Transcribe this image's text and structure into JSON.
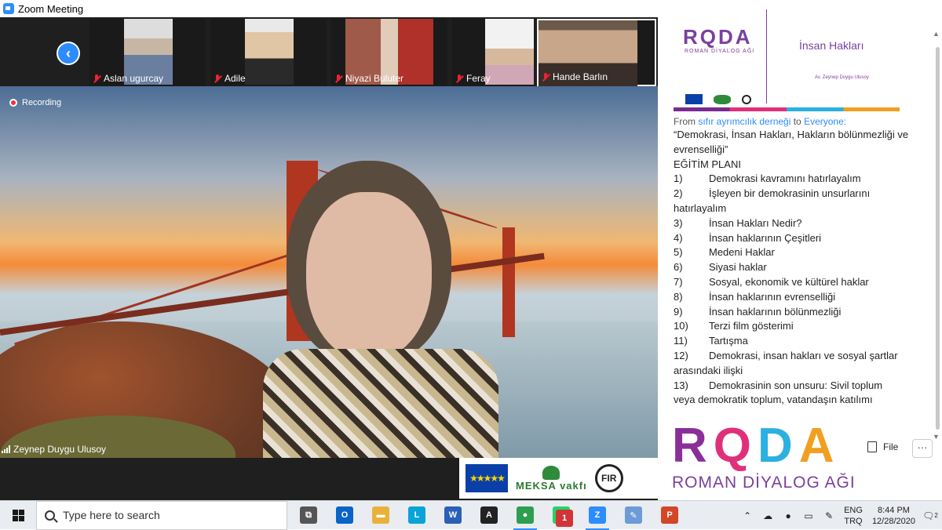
{
  "window": {
    "title": "Zoom Meeting"
  },
  "gallery": {
    "participants": [
      {
        "name": "Aslan ugurcay"
      },
      {
        "name": "Adile"
      },
      {
        "name": "Niyazi Buluter"
      },
      {
        "name": "Feray"
      },
      {
        "name": "Hande Barlın"
      }
    ]
  },
  "main": {
    "recording_label": "Recording",
    "speaker_name": "Zeynep Duygu Ulusoy"
  },
  "sponsors": {
    "eu_stars": "★★★★★",
    "meksa": "MEKSA vakfı",
    "fir": "FIR"
  },
  "slide": {
    "logo": "RQDA",
    "logo_sub": "ROMAN DİYALOG AĞI",
    "title": "İnsan Hakları",
    "subtitle": "Av. Zeynep Duygu Ulusoy"
  },
  "chat": {
    "from_prefix": "From",
    "sender": "sıfır ayrımcılık derneği",
    "to_word": "to",
    "recipient": "Everyone:",
    "lines": [
      {
        "num": "",
        "text": "“Demokrasi, İnsan Hakları, Hakların bölünmezliği ve evrenselliği”"
      },
      {
        "num": "",
        "text": "EĞİTİM PLANI"
      },
      {
        "num": "1)",
        "text": "Demokrasi kavramını hatırlayalım"
      },
      {
        "num": "2)",
        "text": "İşleyen bir demokrasinin unsurlarını"
      },
      {
        "num": "",
        "text": "hatırlayalım"
      },
      {
        "num": "3)",
        "text": "İnsan Hakları Nedir?"
      },
      {
        "num": "4)",
        "text": "İnsan haklarının Çeşitleri"
      },
      {
        "num": "5)",
        "text": "Medeni Haklar"
      },
      {
        "num": "6)",
        "text": "Siyasi haklar"
      },
      {
        "num": "7)",
        "text": "Sosyal, ekonomik ve kültürel haklar"
      },
      {
        "num": "8)",
        "text": "İnsan haklarının evrenselliği"
      },
      {
        "num": "9)",
        "text": "İnsan haklarının bölünmezliği"
      },
      {
        "num": "10)",
        "text": "Terzi film gösterimi"
      },
      {
        "num": "11)",
        "text": "Tartışma"
      },
      {
        "num": "12)",
        "text": "Demokrasi, insan hakları ve sosyal şartlar"
      },
      {
        "num": "",
        "text": "arasındaki ilişki"
      },
      {
        "num": "13)",
        "text": "Demokrasinin son unsuru: Sivil toplum"
      },
      {
        "num": "",
        "text": "veya demokratik toplum, vatandaşın katılımı"
      }
    ],
    "file_label": "File",
    "more_label": "···"
  },
  "brand": {
    "letters": [
      "R",
      "Q",
      "D",
      "A"
    ],
    "sub": "ROMAN DİYALOG AĞI"
  },
  "taskbar": {
    "search_placeholder": "Type here to search",
    "apps": [
      {
        "name": "task-view",
        "glyph": "⧉",
        "color": "#555"
      },
      {
        "name": "outlook",
        "glyph": "O",
        "color": "#0a64c8"
      },
      {
        "name": "file-explorer",
        "glyph": "▬",
        "color": "#e8b23a"
      },
      {
        "name": "l-app",
        "glyph": "L",
        "color": "#0aa3d8"
      },
      {
        "name": "word",
        "glyph": "W",
        "color": "#2b5fb8"
      },
      {
        "name": "acrobat",
        "glyph": "A",
        "color": "#222"
      },
      {
        "name": "chrome",
        "glyph": "●",
        "color": "#2e9e4f"
      },
      {
        "name": "whatsapp",
        "glyph": "W",
        "color": "#25d366",
        "badge": "1"
      },
      {
        "name": "zoom",
        "glyph": "Z",
        "color": "#2d8cff"
      },
      {
        "name": "paint",
        "glyph": "✎",
        "color": "#6c9bd8"
      },
      {
        "name": "powerpoint",
        "glyph": "P",
        "color": "#d24726"
      }
    ],
    "lang_top": "ENG",
    "lang_bottom": "TRQ",
    "time": "8:44 PM",
    "date": "12/28/2020",
    "notif_count": "2"
  }
}
